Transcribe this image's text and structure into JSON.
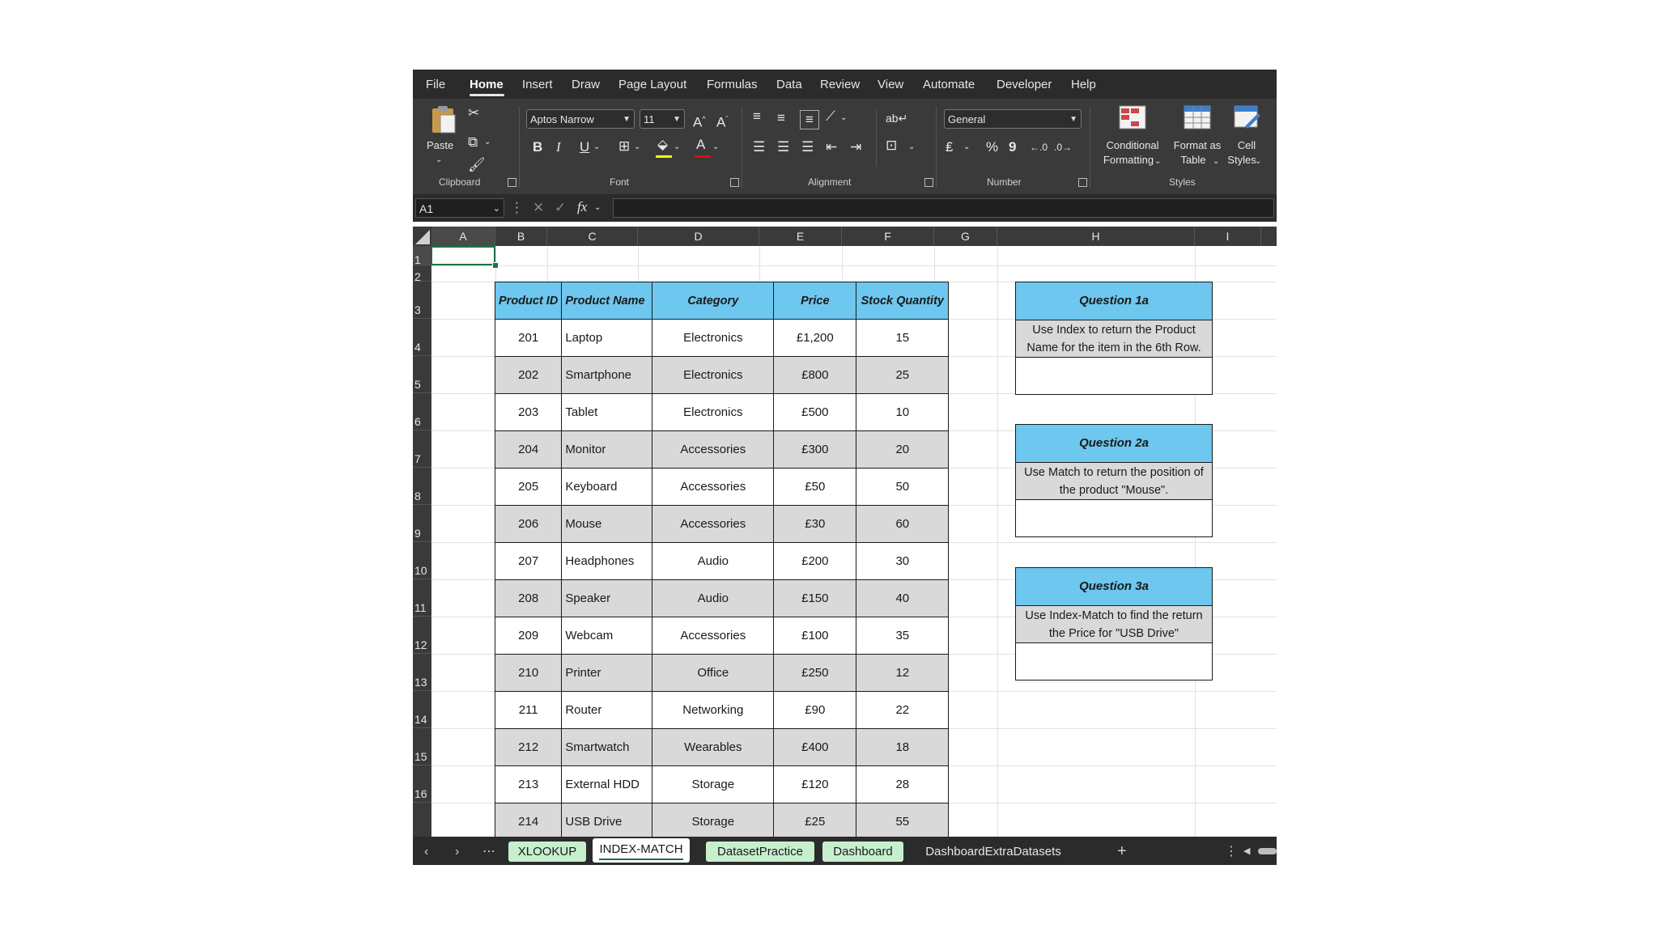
{
  "menu": {
    "items": [
      "File",
      "Home",
      "Insert",
      "Draw",
      "Page Layout",
      "Formulas",
      "Data",
      "Review",
      "View",
      "Automate",
      "Developer",
      "Help"
    ],
    "active": "Home"
  },
  "ribbon": {
    "paste_label": "Paste",
    "clipboard_label": "Clipboard",
    "font_name": "Aptos Narrow",
    "font_size": "11",
    "font_label": "Font",
    "alignment_label": "Alignment",
    "number_format": "General",
    "number_label": "Number",
    "conditional_formatting": "Conditional",
    "conditional_formatting_2": "Formatting",
    "format_as_table": "Format as",
    "format_as_table_2": "Table",
    "cell_styles": "Cell",
    "cell_styles_2": "Styles",
    "styles_label": "Styles",
    "bold": "B",
    "italic": "I",
    "underline": "U",
    "font_color_glyph": "A",
    "percent": "%",
    "comma": "9",
    "fx": "fx",
    "accent_yellow": "#ffff00",
    "accent_red": "#ff0000"
  },
  "formula_bar": {
    "name_box": "A1",
    "formula": ""
  },
  "columns": [
    "A",
    "B",
    "C",
    "D",
    "E",
    "F",
    "G",
    "H",
    "I"
  ],
  "rows": [
    "1",
    "2",
    "3",
    "4",
    "5",
    "6",
    "7",
    "8",
    "9",
    "10",
    "11",
    "12",
    "13",
    "14",
    "15",
    "16"
  ],
  "table": {
    "headers": [
      "Product ID",
      "Product Name",
      "Category",
      "Price",
      "Stock Quantity"
    ],
    "rows": [
      [
        "201",
        "Laptop",
        "Electronics",
        "£1,200",
        "15"
      ],
      [
        "202",
        "Smartphone",
        "Electronics",
        "£800",
        "25"
      ],
      [
        "203",
        "Tablet",
        "Electronics",
        "£500",
        "10"
      ],
      [
        "204",
        "Monitor",
        "Accessories",
        "£300",
        "20"
      ],
      [
        "205",
        "Keyboard",
        "Accessories",
        "£50",
        "50"
      ],
      [
        "206",
        "Mouse",
        "Accessories",
        "£30",
        "60"
      ],
      [
        "207",
        "Headphones",
        "Audio",
        "£200",
        "30"
      ],
      [
        "208",
        "Speaker",
        "Audio",
        "£150",
        "40"
      ],
      [
        "209",
        "Webcam",
        "Accessories",
        "£100",
        "35"
      ],
      [
        "210",
        "Printer",
        "Office",
        "£250",
        "12"
      ],
      [
        "211",
        "Router",
        "Networking",
        "£90",
        "22"
      ],
      [
        "212",
        "Smartwatch",
        "Wearables",
        "£400",
        "18"
      ],
      [
        "213",
        "External HDD",
        "Storage",
        "£120",
        "28"
      ],
      [
        "214",
        "USB Drive",
        "Storage",
        "£25",
        "55"
      ]
    ]
  },
  "questions": [
    {
      "title": "Question 1a",
      "line1": "Use Index to return the Product",
      "line2": "Name for the item in the 6th Row."
    },
    {
      "title": "Question 2a",
      "line1": "Use Match to return the position of",
      "line2": "the product \"Mouse\"."
    },
    {
      "title": "Question 3a",
      "line1": "Use Index-Match to find the return",
      "line2": "the Price for \"USB Drive\""
    }
  ],
  "sheet_tabs": {
    "tabs": [
      "XLOOKUP",
      "INDEX-MATCH",
      "DatasetPractice",
      "Dashboard",
      "DashboardExtraDatasets"
    ],
    "active": "INDEX-MATCH",
    "add_glyph": "+",
    "more_glyph": "⋯"
  }
}
